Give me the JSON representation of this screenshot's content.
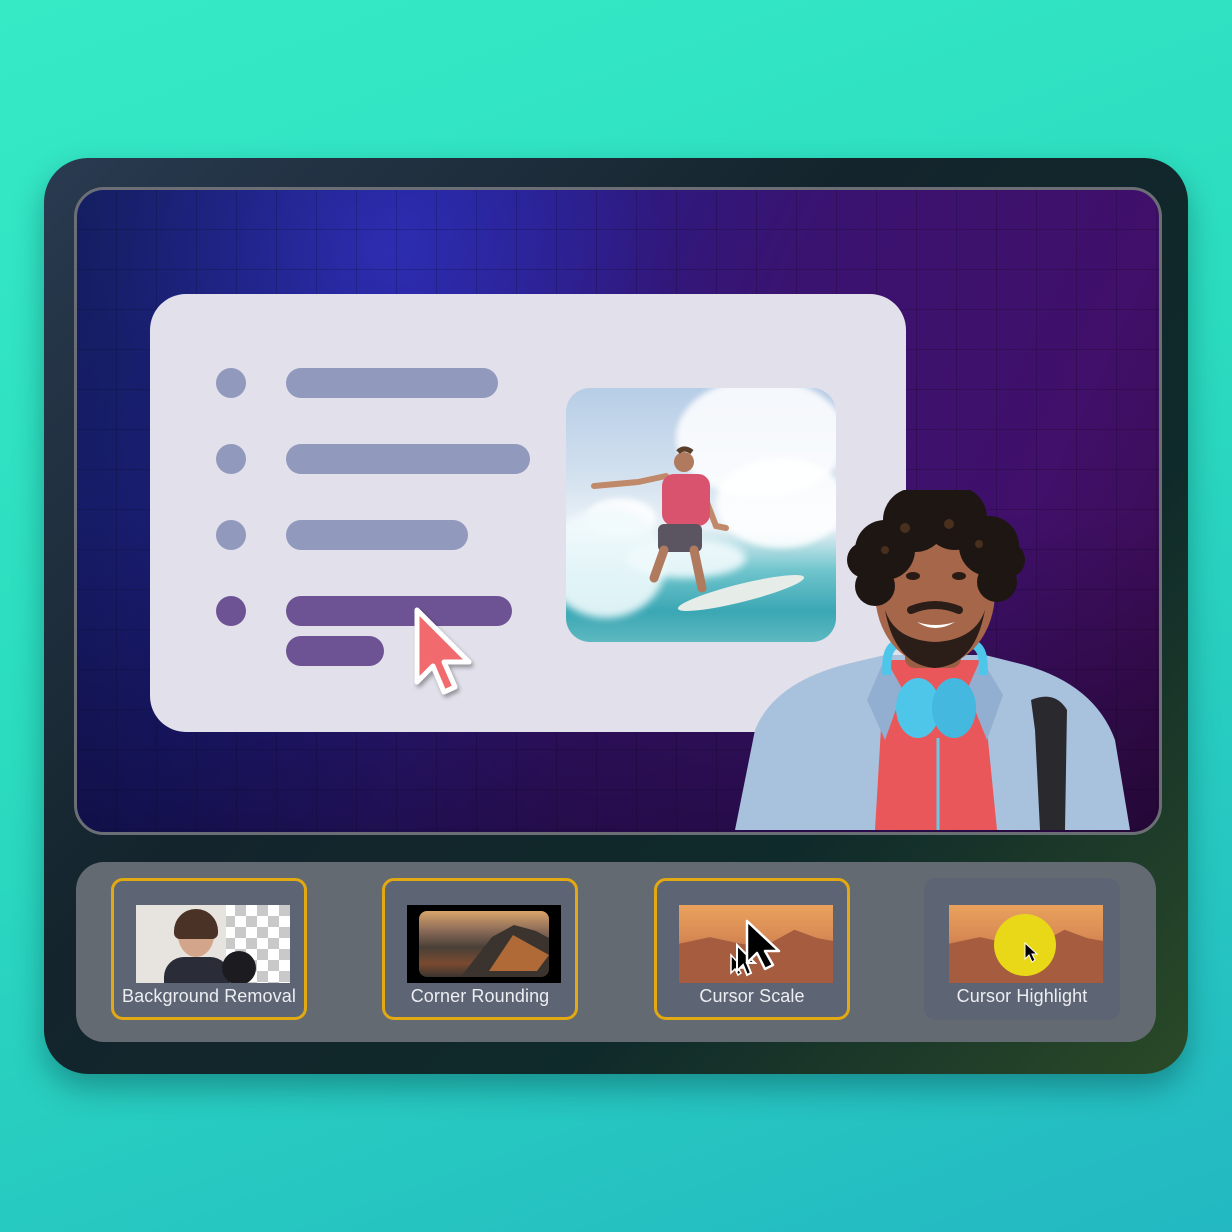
{
  "scene": {
    "background_colors": [
      "#36eac6",
      "#23b8c2"
    ],
    "stage_colors": [
      "#1a2a80",
      "#40106a"
    ],
    "accent_highlight": "#e3a912"
  },
  "document_card": {
    "list_items": [
      {
        "state": "default",
        "lines": [
          0.75
        ]
      },
      {
        "state": "default",
        "lines": [
          0.86
        ]
      },
      {
        "state": "default",
        "lines": [
          0.64
        ]
      },
      {
        "state": "selected",
        "lines": [
          0.8,
          0.35
        ]
      }
    ],
    "photo": {
      "subject": "surfer riding a wave"
    }
  },
  "cursor": {
    "icon": "pointer-arrow-icon",
    "color": "#f06a6e"
  },
  "presenter": {
    "subject": "smiling man with curly hair and blue headphones"
  },
  "toolbar": {
    "tools": [
      {
        "label": "Background Removal",
        "selected": true,
        "thumbnail": "woman with transparent checkered background"
      },
      {
        "label": "Corner Rounding",
        "selected": true,
        "thumbnail": "mountain landscape with rounded corners"
      },
      {
        "label": "Cursor Scale",
        "selected": true,
        "thumbnail": "enlarged cursor over sunset mountains"
      },
      {
        "label": "Cursor Highlight",
        "selected": false,
        "thumbnail": "cursor with yellow highlight circle over sunset"
      }
    ]
  }
}
